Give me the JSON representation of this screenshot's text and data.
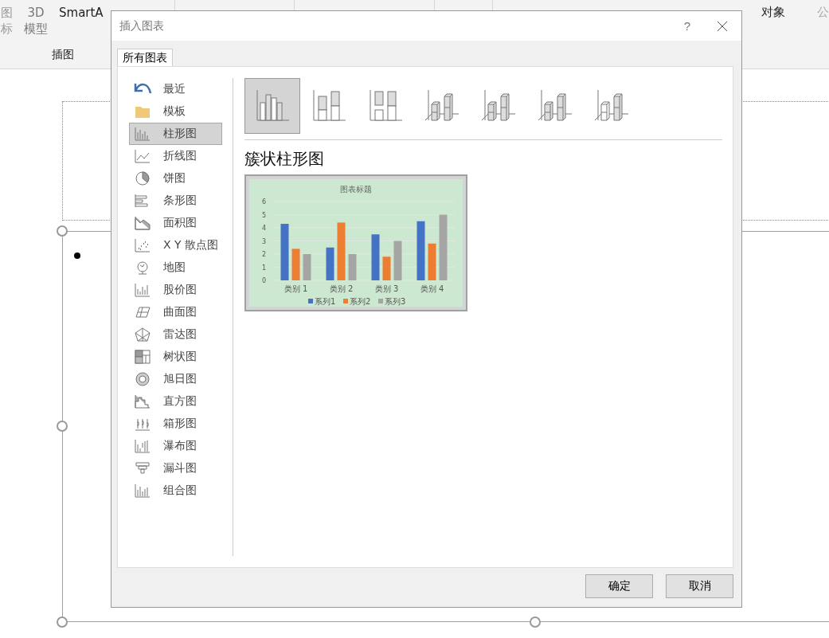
{
  "ribbon": {
    "items": [
      {
        "kind": "tall",
        "text": "图标"
      },
      {
        "kind": "tall",
        "text": "3D 模型"
      },
      {
        "kind": "label",
        "text": "SmartA"
      }
    ],
    "group_label": "插图",
    "right_items": [
      {
        "text": "对象",
        "disabled": false
      },
      {
        "text": "公",
        "disabled": true
      }
    ]
  },
  "dialog": {
    "title": "插入图表",
    "help": "?",
    "tab": "所有图表",
    "categories": [
      {
        "label": "最近",
        "selected": false
      },
      {
        "label": "模板",
        "selected": false
      },
      {
        "label": "柱形图",
        "selected": true
      },
      {
        "label": "折线图",
        "selected": false
      },
      {
        "label": "饼图",
        "selected": false
      },
      {
        "label": "条形图",
        "selected": false
      },
      {
        "label": "面积图",
        "selected": false
      },
      {
        "label": "X Y 散点图",
        "selected": false
      },
      {
        "label": "地图",
        "selected": false
      },
      {
        "label": "股价图",
        "selected": false
      },
      {
        "label": "曲面图",
        "selected": false
      },
      {
        "label": "雷达图",
        "selected": false
      },
      {
        "label": "树状图",
        "selected": false
      },
      {
        "label": "旭日图",
        "selected": false
      },
      {
        "label": "直方图",
        "selected": false
      },
      {
        "label": "箱形图",
        "selected": false
      },
      {
        "label": "瀑布图",
        "selected": false
      },
      {
        "label": "漏斗图",
        "selected": false
      },
      {
        "label": "组合图",
        "selected": false
      }
    ],
    "subtypes": [
      {
        "selected": true
      },
      {
        "selected": false
      },
      {
        "selected": false
      },
      {
        "selected": false
      },
      {
        "selected": false
      },
      {
        "selected": false
      },
      {
        "selected": false
      }
    ],
    "subtype_title": "簇状柱形图",
    "preview": {
      "chart_data": {
        "type": "bar",
        "title": "图表标题",
        "grid": true,
        "legend": true,
        "categories": [
          "类别 1",
          "类别 2",
          "类别 3",
          "类别 4"
        ],
        "yticks": [
          0,
          1,
          2,
          3,
          4,
          5,
          6
        ],
        "ylim": [
          0,
          6
        ],
        "series": [
          {
            "name": "系列1",
            "color": "#4472c4",
            "values": [
              4.3,
              2.5,
              3.5,
              4.5
            ]
          },
          {
            "name": "系列2",
            "color": "#ed7d31",
            "values": [
              2.4,
              4.4,
              1.8,
              2.8
            ]
          },
          {
            "name": "系列3",
            "color": "#a5a5a5",
            "values": [
              2,
              2,
              3,
              5
            ]
          }
        ]
      }
    },
    "buttons": [
      {
        "label": "确定"
      },
      {
        "label": "取消"
      }
    ]
  }
}
